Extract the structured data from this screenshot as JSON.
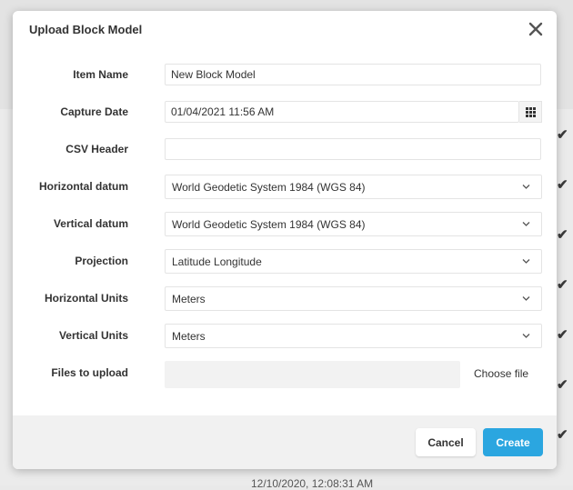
{
  "modal": {
    "title": "Upload Block Model",
    "fields": {
      "item_name": {
        "label": "Item Name",
        "value": "New Block Model"
      },
      "capture_date": {
        "label": "Capture Date",
        "value": "01/04/2021 11:56 AM"
      },
      "csv_header": {
        "label": "CSV Header",
        "value": ""
      },
      "horizontal_datum": {
        "label": "Horizontal datum",
        "selected": "World Geodetic System 1984 (WGS 84)"
      },
      "vertical_datum": {
        "label": "Vertical datum",
        "selected": "World Geodetic System 1984 (WGS 84)"
      },
      "projection": {
        "label": "Projection",
        "selected": "Latitude Longitude"
      },
      "horizontal_units": {
        "label": "Horizontal Units",
        "selected": "Meters"
      },
      "vertical_units": {
        "label": "Vertical Units",
        "selected": "Meters"
      },
      "files": {
        "label": "Files to upload",
        "choose_label": "Choose file"
      }
    },
    "buttons": {
      "cancel": "Cancel",
      "create": "Create"
    }
  },
  "background": {
    "bottom_timestamp": "12/10/2020, 12:08:31 AM"
  },
  "colors": {
    "primary": "#2ba6e0",
    "footer_bg": "#f1f1f1"
  }
}
